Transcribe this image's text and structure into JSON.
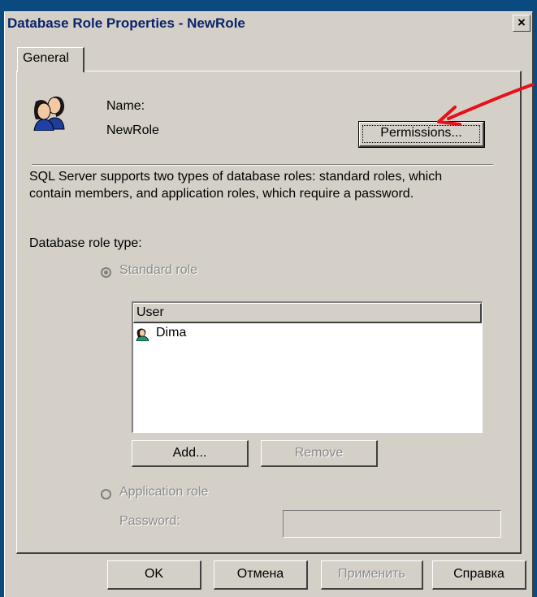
{
  "window": {
    "title": "Database Role Properties - NewRole",
    "close_glyph": "×"
  },
  "tabs": [
    {
      "label": "General"
    }
  ],
  "general": {
    "name_label": "Name:",
    "name_value": "NewRole",
    "permissions_button": "Permissions...",
    "description": [
      "SQL Server supports two types of database roles: standard roles, which",
      "contain members, and application roles, which require a password."
    ],
    "role_type_label": "Database role type:",
    "standard_role_label": "Standard role",
    "standard_role_selected": true,
    "members_table": {
      "header": "User",
      "rows": [
        {
          "icon": "user-icon",
          "name": "Dima"
        }
      ]
    },
    "add_button": "Add...",
    "remove_button": "Remove",
    "application_role_label": "Application role",
    "password_label": "Password:",
    "password_value": ""
  },
  "footer": {
    "ok_button": "OK",
    "cancel_button": "Отмена",
    "apply_button": "Применить",
    "help_button": "Справка"
  },
  "annotation": {
    "type": "red-arrow",
    "color": "#e8101a"
  },
  "colors": {
    "desktop": "#0b4a7e",
    "dialog_face": "#d4d0c8",
    "title_text": "#0a246a",
    "disabled_text": "#8a8a8a"
  }
}
